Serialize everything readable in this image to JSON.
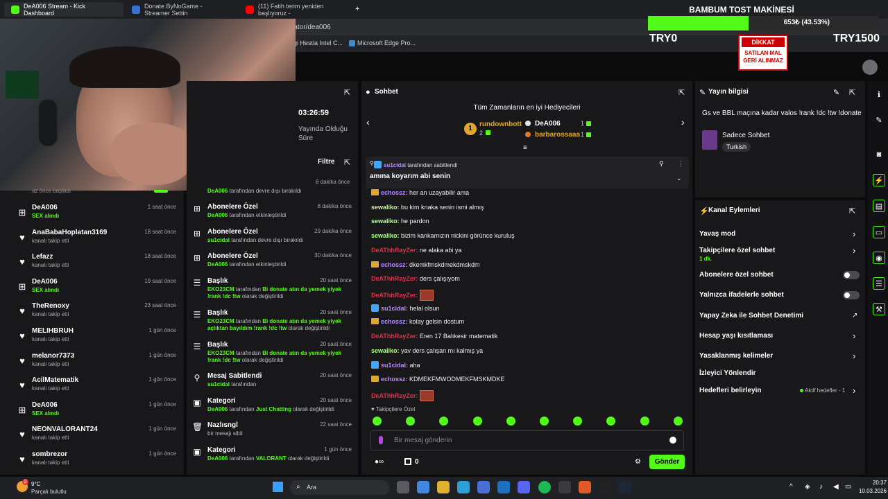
{
  "tabs": [
    {
      "label": "DeA006 Stream - Kick Dashboard",
      "color": "#53fc18"
    },
    {
      "label": "Donate ByNoGame - Streamer Settin",
      "color": "#3a6fd8"
    },
    {
      "label": "(11) Fatih terim yeniden başlıyoruz -",
      "color": "#ff0000"
    }
  ],
  "url": "rator/dea006",
  "bookmarks": [
    "rgi Hestia Intel C...",
    "Microsoft Edge Pro..."
  ],
  "overlay": {
    "title": "BAMBUM TOST MAKİNESİ",
    "percent_text": "653₺ (43.53%)",
    "progress": 0.4353,
    "left": "TRY0",
    "right": "TRY1500",
    "sign1": "DİKKAT",
    "sign2": "SATILAN MAL",
    "sign3": "GERİ ALINMAZ"
  },
  "panelA": {
    "partial_top": "az önce başladı",
    "rows": [
      {
        "icon": "gift",
        "name": "DeA006",
        "sub": "SEX alındı",
        "green": true,
        "time": "1 saat önce"
      },
      {
        "icon": "heart",
        "name": "AnaBabaHoplatan3169",
        "sub": "kanalı takip etti",
        "green": false,
        "time": "18 saat önce"
      },
      {
        "icon": "heart",
        "name": "Lefazz",
        "sub": "kanalı takip etti",
        "green": false,
        "time": "18 saat önce"
      },
      {
        "icon": "gift",
        "name": "DeA006",
        "sub": "SEX alındı",
        "green": true,
        "time": "19 saat önce"
      },
      {
        "icon": "heart",
        "name": "TheRenoxy",
        "sub": "kanalı takip etti",
        "green": false,
        "time": "23 saat önce"
      },
      {
        "icon": "heart",
        "name": "MELIHBRUH",
        "sub": "kanalı takip etti",
        "green": false,
        "time": "1 gün önce"
      },
      {
        "icon": "heart",
        "name": "melanor7373",
        "sub": "kanalı takip etti",
        "green": false,
        "time": "1 gün önce"
      },
      {
        "icon": "heart",
        "name": "AcilMatematik",
        "sub": "kanalı takip etti",
        "green": false,
        "time": "1 gün önce"
      },
      {
        "icon": "gift",
        "name": "DeA006",
        "sub": "SEX alındı",
        "green": true,
        "time": "1 gün önce"
      },
      {
        "icon": "heart",
        "name": "NEONVALORANT24",
        "sub": "kanalı takip etti",
        "green": false,
        "time": "1 gün önce"
      },
      {
        "icon": "heart",
        "name": "sombrezor",
        "sub": "kanalı takip etti",
        "green": false,
        "time": "1 gün önce"
      }
    ]
  },
  "panelB": {
    "session_time": "03:26:59",
    "session_label": "Yayında Olduğu Süre",
    "filter_label": "Filtre",
    "partial_top": {
      "text": "tarafından devre dışı bırakıldı",
      "user": "DeA006",
      "time": "8 dakika önce"
    },
    "rows": [
      {
        "icon": "gift",
        "title": "Abonelere Özel",
        "time": "8 dakika önce",
        "user": "DeA006",
        "rest": "tarafından etkinleştirildi"
      },
      {
        "icon": "gift",
        "title": "Abonelere Özel",
        "time": "29 dakika önce",
        "user": "su1cidal",
        "rest": "tarafından devre dışı bırakıldı"
      },
      {
        "icon": "gift",
        "title": "Abonelere Özel",
        "time": "30 dakika önce",
        "user": "DeA006",
        "rest": "tarafından etkinleştirildi"
      },
      {
        "icon": "chat",
        "title": "Başlık",
        "time": "20 saat önce",
        "user": "EKO23CM",
        "rest": "tarafından",
        "hl": "Bi donate atın da yemek yiyek !rank !dc !tw",
        "rest2": "olarak değiştirildi"
      },
      {
        "icon": "chat",
        "title": "Başlık",
        "time": "20 saat önce",
        "user": "EKO23CM",
        "rest": "tarafından",
        "hl": "Bi donate atın da yemek yiyek açlıktan bayıldım !rank !dc !tw",
        "rest2": "olarak değiştirildi"
      },
      {
        "icon": "chat",
        "title": "Başlık",
        "time": "20 saat önce",
        "user": "EKO23CM",
        "rest": "tarafından",
        "hl": "Bi donate atın da yemek yiyek !rank !dc !tw",
        "rest2": "olarak değiştirildi"
      },
      {
        "icon": "pin",
        "title": "Mesaj Sabitlendi",
        "time": "20 saat önce",
        "user": "su1cidal",
        "rest": "tarafından"
      },
      {
        "icon": "tv",
        "title": "Kategori",
        "time": "20 saat önce",
        "user": "DeA006",
        "rest": "tarafından",
        "hl": "Just Chatting",
        "rest2": "olarak değiştirildi"
      },
      {
        "icon": "trash",
        "title": "Nazlısngl",
        "time": "22 saat önce",
        "user": "",
        "rest": "bir mesajı sildi"
      },
      {
        "icon": "tv",
        "title": "Kategori",
        "time": "1 gün önce",
        "user": "DeA006",
        "rest": "tarafından",
        "hl": "VALORANT",
        "rest2": "olarak değiştirildi"
      }
    ]
  },
  "chat": {
    "title": "Sohbet",
    "gifters_title": "Tüm Zamanların en iyi Hediyecileri",
    "gifters": [
      {
        "rank": "1",
        "name": "rundownbott",
        "count": "1",
        "color": "#e0a72a"
      },
      {
        "rank": "2",
        "name": "",
        "count": "1",
        "color": "#bdbdbd"
      },
      {
        "rank": "",
        "name": "DeA006",
        "count": "1",
        "color": "#ffffff"
      },
      {
        "rank": "",
        "name": "barbarossaaa",
        "count": "1",
        "color": "#e0a72a"
      }
    ],
    "pinned_by": "su1cidal",
    "pinned_by_rest": "tarafından sabitlendi",
    "pinned_msg": "amına koyarım abi senin",
    "messages": [
      {
        "badge": "crown",
        "user": "echossz:",
        "color": "#b78cff",
        "text": "her an uzayabilir ama"
      },
      {
        "badge": "",
        "user": "sewaliko:",
        "color": "#b5ff8c",
        "text": "bu kim knaka senin ismi almış"
      },
      {
        "badge": "",
        "user": "sewaliko:",
        "color": "#b5ff8c",
        "text": "he pardon"
      },
      {
        "badge": "",
        "user": "sewaliko:",
        "color": "#b5ff8c",
        "text": "bizim kankamızın nickini görünce kuruluş"
      },
      {
        "badge": "",
        "user": "DeAThhRayZer:",
        "color": "#e0304a",
        "text": "ne alaka abi ya"
      },
      {
        "badge": "crown",
        "user": "echossz:",
        "color": "#b78cff",
        "text": "dkemkfmskdmekdmskdm"
      },
      {
        "badge": "",
        "user": "DeAThhRayZer:",
        "color": "#e0304a",
        "text": "ders çalışıyom"
      },
      {
        "badge": "",
        "user": "DeAThhRayZer:",
        "color": "#e0304a",
        "text": "",
        "emote": true
      },
      {
        "badge": "tw",
        "user": "su1cidal:",
        "color": "#b78cff",
        "text": "helal olsun"
      },
      {
        "badge": "crown",
        "user": "echossz:",
        "color": "#b78cff",
        "text": "kolay gelsin dostum"
      },
      {
        "badge": "",
        "user": "DeAThhRayZer:",
        "color": "#e0304a",
        "text": "Eren 17 Balıkesir matematik"
      },
      {
        "badge": "",
        "user": "sewaliko:",
        "color": "#b5ff8c",
        "text": "yav ders çalışan mı kalmış ya"
      },
      {
        "badge": "tw",
        "user": "su1cidal:",
        "color": "#b78cff",
        "text": "aha"
      },
      {
        "badge": "crown",
        "user": "echossz:",
        "color": "#b78cff",
        "text": "KDMEKFMWODMEKFMSKMDKE"
      },
      {
        "badge": "",
        "user": "DeAThhRayZer:",
        "color": "#e0304a",
        "text": "",
        "emote": true
      }
    ],
    "followers_only": "Takipçilere Özel",
    "input_placeholder": "Bir mesaj gönderin",
    "send_label": "Gönder",
    "points": "0"
  },
  "streaminfo": {
    "title": "Yayın bilgisi",
    "stream_title": "Gs ve BBL maçına kadar valos !rank !dc !tw !donate",
    "category": "Sadece Sohbet",
    "language": "Turkish"
  },
  "channel_actions": {
    "title": "Kanal Eylemleri",
    "items": [
      {
        "label": "Yavaş mod",
        "control": "chevron"
      },
      {
        "label": "Takipçilere özel sohbet",
        "control": "chevron",
        "sub": "1 dk."
      },
      {
        "label": "Abonelere özel sohbet",
        "control": "toggle"
      },
      {
        "label": "Yalnızca ifadelerle sohbet",
        "control": "toggle"
      },
      {
        "label": "Yapay Zeka ile Sohbet Denetimi",
        "control": "external"
      },
      {
        "label": "Hesap yaşı kısıtlaması",
        "control": "chevron"
      },
      {
        "label": "Yasaklanmış kelimeler",
        "control": "chevron"
      },
      {
        "label": "İzleyici Yönlendir",
        "control": "none"
      },
      {
        "label": "Hedefleri belirleyin",
        "control": "chevron",
        "sub": "Aktif hedefler - 1"
      }
    ]
  },
  "taskbar": {
    "weather_temp": "9°C",
    "weather_desc": "Parçalı bulutlu",
    "search": "Ara",
    "time": "20:37",
    "date": "10.03.2026",
    "weather_badge": "2"
  }
}
